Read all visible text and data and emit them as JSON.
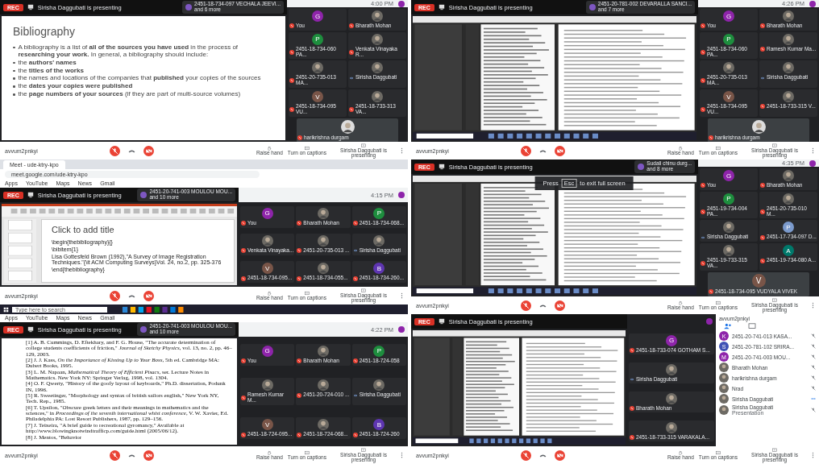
{
  "panels": [
    {
      "meeting": {
        "rec": "REC",
        "presenter": "Sirisha Daggubati is presenting",
        "chip": {
          "name": "2451-18-734-097 VECHALA JEEVI...",
          "more": "and 6 more"
        },
        "time": "4:00 PM",
        "content": {
          "kind": "slide",
          "title": "Bibliography",
          "bullets": [
            "A bibliography is a list of **all of the sources you have used** in the process of **researching your work.** In general, a bibliography should include:",
            "the **authors' names**",
            "the **titles of the works**",
            "the names and locations of the companies that **published** your copies of the sources",
            "the **dates your copies were published**",
            "the **page numbers of your sources** (if they are part of multi-source volumes)"
          ]
        },
        "participants": [
          {
            "name": "You",
            "kind": "letter",
            "letter": "G",
            "color": "#8e24aa",
            "muted": true
          },
          {
            "name": "Bharath Mohan",
            "kind": "photo",
            "muted": true
          },
          {
            "name": "2451-18-734-060 PA...",
            "kind": "letter",
            "letter": "P",
            "color": "#1e8e3e",
            "muted": true
          },
          {
            "name": "Venkata Vinayaka R...",
            "kind": "photo",
            "muted": true
          },
          {
            "name": "2451-20-735-013 MA...",
            "kind": "photo",
            "muted": true
          },
          {
            "name": "Sirisha Daggubati",
            "kind": "photo",
            "muted": false
          },
          {
            "name": "2451-18-734-095 VU...",
            "kind": "letter",
            "letter": "V",
            "color": "#795548",
            "muted": true
          },
          {
            "name": "2451-18-733-313 VA...",
            "kind": "photo",
            "muted": true
          }
        ],
        "featured": {
          "name": "harikrishna durgam",
          "kind": "photo",
          "muted": true
        }
      },
      "controls": {
        "account": "avvum2pnkyi",
        "actions": [
          {
            "kind": "hand",
            "label": "Raise hand"
          },
          {
            "kind": "captions",
            "label": "Turn on captions"
          },
          {
            "kind": "present",
            "label": "Sirisha Daggubati is presenting"
          }
        ]
      }
    },
    {
      "meeting": {
        "rec": "REC",
        "presenter": "Sirisha Daggubati is presenting",
        "chip": {
          "name": "2451-20-781-002 DEVARALLA SANCI...",
          "more": "and 7 more"
        },
        "time": "4:26 PM",
        "content": {
          "kind": "document"
        },
        "participants": [
          {
            "name": "You",
            "kind": "letter",
            "letter": "G",
            "color": "#8e24aa",
            "muted": true
          },
          {
            "name": "Bharath Mohan",
            "kind": "photo",
            "muted": true
          },
          {
            "name": "2451-18-734-060 PA...",
            "kind": "letter",
            "letter": "P",
            "color": "#1e8e3e",
            "muted": true
          },
          {
            "name": "Ramesh Kumar Ma...",
            "kind": "photo",
            "muted": true
          },
          {
            "name": "2451-20-735-013 MA...",
            "kind": "photo",
            "muted": true
          },
          {
            "name": "Sirisha Daggubati",
            "kind": "photo",
            "muted": false
          },
          {
            "name": "2451-18-734-095 VU...",
            "kind": "letter",
            "letter": "V",
            "color": "#795548",
            "muted": true
          },
          {
            "name": "2451-18-733-315 V...",
            "kind": "photo",
            "muted": true
          }
        ],
        "featured": {
          "name": "harikrishna durgam",
          "kind": "photo",
          "muted": true
        }
      },
      "controls": {
        "account": "avvum2pnkyi",
        "actions": [
          {
            "kind": "hand",
            "label": "Raise hand"
          },
          {
            "kind": "captions",
            "label": "Turn on captions"
          },
          {
            "kind": "present",
            "label": "Sirisha Daggubati is presenting"
          }
        ]
      }
    },
    {
      "browser": {
        "tab": "Meet - ude-ktry-kpo",
        "url": "meet.google.com/ude-ktry-kpo",
        "bookmarks": [
          "Apps",
          "YouTube",
          "Maps",
          "News",
          "Gmail"
        ]
      },
      "meeting": {
        "rec": "REC",
        "presenter": "Sirisha Daggubati is presenting",
        "chip": {
          "name": "2451-20-741-003 MOULOU MOU...",
          "more": "and 10 more"
        },
        "time": "4:15 PM",
        "content": {
          "kind": "latex_slide",
          "title": "Click to add title",
          "lines": [
            "\\begin{thebibliography}{}",
            "\\bibitem{1}",
            "Lisa Gottesfeld Brown (1992),\"A Survey of Image Registration Techniques.\"{\\it ACM Computing Surveys}Vol. 24, no.2, pp. 325-376",
            "\\end{thebibliography}"
          ]
        },
        "participants": [
          {
            "name": "You",
            "kind": "letter",
            "letter": "G",
            "color": "#8e24aa",
            "muted": true
          },
          {
            "name": "Bharath Mohan",
            "kind": "photo",
            "muted": true
          },
          {
            "name": "2451-18-734-068...",
            "kind": "letter",
            "letter": "P",
            "color": "#1e8e3e",
            "muted": true
          },
          {
            "name": "Venkata Vinayaka...",
            "kind": "photo",
            "muted": true
          },
          {
            "name": "2451-20-735-013 ...",
            "kind": "photo",
            "muted": true
          },
          {
            "name": "Sirisha Daggubati",
            "kind": "photo",
            "muted": false
          },
          {
            "name": "2451-18-734-095...",
            "kind": "letter",
            "letter": "V",
            "color": "#795548",
            "muted": true
          },
          {
            "name": "2451-18-734-055...",
            "kind": "photo",
            "muted": true
          },
          {
            "name": "2451-18-734-260...",
            "kind": "letter",
            "letter": "B",
            "color": "#5e35b1",
            "muted": true
          }
        ]
      },
      "controls": {
        "account": "avvum2pnkyi",
        "actions": [
          {
            "kind": "hand",
            "label": "Raise hand"
          },
          {
            "kind": "captions",
            "label": "Turn on captions"
          },
          {
            "kind": "present",
            "label": "Sirisha Daggubati is presenting"
          }
        ]
      },
      "taskbar": {
        "search": "Type here to search"
      }
    },
    {
      "meeting": {
        "rec": "REC",
        "presenter": "Sirisha Daggubati is presenting",
        "chip": {
          "name": "Sudali chinu durg...",
          "more": "and 8 more"
        },
        "time": "4:35 PM",
        "content": {
          "kind": "document"
        },
        "overlay": {
          "before": "Press",
          "key": "Esc",
          "after": "to exit full screen"
        },
        "participants": [
          {
            "name": "You",
            "kind": "letter",
            "letter": "G",
            "color": "#8e24aa",
            "muted": true
          },
          {
            "name": "Bharath Mohan",
            "kind": "photo",
            "muted": true
          },
          {
            "name": "2451-19-734-004 PA...",
            "kind": "letter",
            "letter": "P",
            "color": "#1e8e3e",
            "muted": true
          },
          {
            "name": "2451-20-735-010 M...",
            "kind": "photo",
            "muted": true
          },
          {
            "name": "Sirisha Daggubati",
            "kind": "photo",
            "muted": false
          },
          {
            "name": "2451-17-734-097 D...",
            "kind": "letter",
            "letter": "P",
            "color": "#7b9acc",
            "muted": true
          },
          {
            "name": "2451-19-733-315 VA...",
            "kind": "photo",
            "muted": true
          },
          {
            "name": "2451-19-734-080 A...",
            "kind": "letter",
            "letter": "A",
            "color": "#00796b",
            "muted": true
          }
        ],
        "featured": {
          "name": "2451-18-734-095 VUDYALA VIVEK",
          "kind": "letter",
          "letter": "V",
          "color": "#795548",
          "muted": true
        }
      },
      "controls": {
        "account": "avvum2pnkyi",
        "actions": [
          {
            "kind": "hand",
            "label": "Raise hand"
          },
          {
            "kind": "captions",
            "label": "Turn on captions"
          },
          {
            "kind": "present",
            "label": "Sirisha Daggubati is presenting"
          }
        ]
      }
    },
    {
      "browser": {
        "bookmarks": [
          "Apps",
          "YouTube",
          "Maps",
          "News",
          "Gmail"
        ]
      },
      "meeting": {
        "rec": "REC",
        "presenter": "Sirisha Daggubati is presenting",
        "chip": {
          "name": "2451-20-741-003 MOULOU MOU...",
          "more": "and 10 more"
        },
        "time": "4:22 PM",
        "content": {
          "kind": "references",
          "refs": [
            "[1] A. B. Cummings, D. Eftekhary, and F. G. House, \"The accurate determination of college students coefficients of friction,\" *Journal of Sketchy Physics*, vol. 13, no. 2, pp. 46–129, 2003.",
            "[2] J. J. Kass, *On the Importance of Kissing Up to Your Boss*, 5th ed. Cambridge MA: Dubert Books, 1995.",
            "[3] L. M. Napaan, *Mathematical Theory of Efficient Pisacs*, ser. Lecture Notes in Mathematics. New York NY: Springer Verlag, 1998, vol. 1304.",
            "[4] O. F. Qwerty, \"History of the goofy layout of keyboards,\" Ph.D. dissertation, Podunk IN, 1996.",
            "[5] R. Sweetinger, \"Morphology and syntax of british sailors english,\" New York NY, Tech. Rep., 1985.",
            "[6] T. Upsilon, \"Obscure greek letters and their meanings in mathematics and the sciences,\" in *Proceedings of the seventh international whist conference*, V. W. Xavier, Ed. Philadelphia PA: Lost Resort Publishers, 1987, pp. 129–156.",
            "[7] J. Teixeira, \"A brief guide to recreational gyromancy,\" Available at http://www.blowingknotwindtrafficp.com/guide.html (2005/06/12).",
            "[8] J. Mentos, \"Behavior"
          ]
        },
        "participants": [
          {
            "name": "You",
            "kind": "letter",
            "letter": "G",
            "color": "#8e24aa",
            "muted": true
          },
          {
            "name": "Bharath Mohan",
            "kind": "photo",
            "muted": true
          },
          {
            "name": "2451-18-724-058",
            "kind": "letter",
            "letter": "P",
            "color": "#1e8e3e",
            "muted": true
          },
          {
            "name": "Ramesh Kumar M...",
            "kind": "photo",
            "muted": true
          },
          {
            "name": "2451-20-724-010 ...",
            "kind": "photo",
            "muted": true
          },
          {
            "name": "Sirisha Daggubati",
            "kind": "photo",
            "muted": false
          },
          {
            "name": "2451-18-724-095...",
            "kind": "letter",
            "letter": "V",
            "color": "#795548",
            "muted": true
          },
          {
            "name": "2451-18-724-068...",
            "kind": "photo",
            "muted": true
          },
          {
            "name": "2451-18-724-260",
            "kind": "letter",
            "letter": "B",
            "color": "#5e35b1",
            "muted": true
          }
        ]
      },
      "controls": {
        "account": "avvum2pnkyi",
        "actions": [
          {
            "kind": "hand",
            "label": "Raise hand"
          },
          {
            "kind": "captions",
            "label": "Turn on captions"
          },
          {
            "kind": "present",
            "label": "Sirisha Daggubati is presenting"
          }
        ]
      }
    },
    {
      "meeting": {
        "rec": "REC",
        "presenter": "Sirisha Daggubati is presenting",
        "content": {
          "kind": "document"
        },
        "participants": [
          {
            "name": "2451-18-733-074 GOTHAM S...",
            "kind": "letter",
            "letter": "G",
            "color": "#8e24aa",
            "muted": true
          },
          {
            "name": "Sirisha Daggubati",
            "kind": "photo",
            "muted": false
          },
          {
            "name": "Bharath Mohan",
            "kind": "photo",
            "muted": true
          },
          {
            "name": "2451-18-733-315 VARAKALA...",
            "kind": "photo",
            "muted": true
          }
        ],
        "people_panel": {
          "account": "avvum2pnkyi",
          "people": [
            {
              "name": "2451-20-741-013 KASA...",
              "kind": "letter",
              "letter": "K",
              "color": "#8e24aa",
              "muted": true
            },
            {
              "name": "2451-20-781-102 SRIRA...",
              "kind": "letter",
              "letter": "S",
              "color": "#3f51b5",
              "muted": true
            },
            {
              "name": "2451-20-741-003 MOU...",
              "kind": "letter",
              "letter": "M",
              "color": "#8e24aa",
              "muted": true
            },
            {
              "name": "Bharath Mohan",
              "kind": "photo",
              "muted": true
            },
            {
              "name": "harikrishna durgam",
              "kind": "photo",
              "muted": true
            },
            {
              "name": "Nrad",
              "kind": "photo",
              "muted": true
            },
            {
              "name": "Sirisha Daggubati",
              "kind": "photo",
              "muted": false
            },
            {
              "name": "Sirisha Daggubati",
              "sub": "Presentation",
              "kind": "photo",
              "muted": true
            }
          ]
        }
      },
      "controls": {
        "account": "avvum2pnkyi",
        "actions": [
          {
            "kind": "hand",
            "label": "Raise hand"
          },
          {
            "kind": "captions",
            "label": "Turn on captions"
          },
          {
            "kind": "present",
            "label": "Sirisha Daggubati is presenting"
          }
        ]
      }
    }
  ]
}
